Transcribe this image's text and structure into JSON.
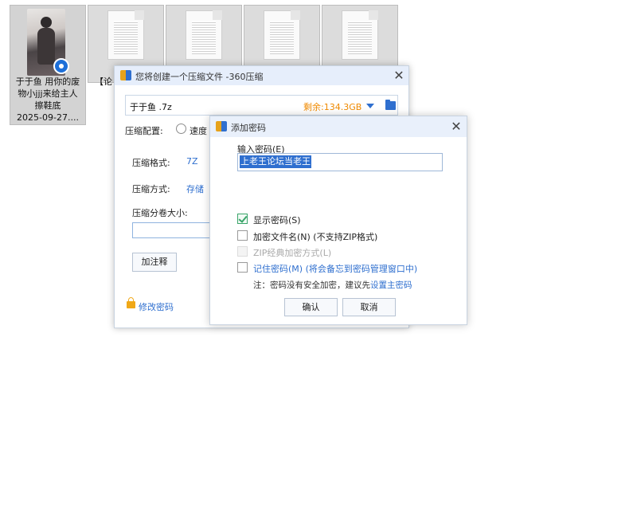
{
  "desktop": {
    "files": [
      {
        "label": "于于鱼 用你的废\n物小jjj来给主人\n擦鞋底\n2025-09-27....",
        "selected": true,
        "icon": "video-thumbnail"
      },
      {
        "label": "【论",
        "selected": false,
        "icon": "text-document-icon"
      },
      {
        "label": "",
        "selected": false,
        "icon": "text-document-icon"
      },
      {
        "label": "",
        "selected": false,
        "icon": "text-document-icon"
      },
      {
        "label": "",
        "selected": false,
        "icon": "text-document-icon"
      }
    ]
  },
  "main_dialog": {
    "title": "您将创建一个压缩文件 -360压缩",
    "path": "于于鱼 .7z",
    "free_space": "剩余:134.3GB",
    "config_label": "压缩配置:",
    "config_option": "速度",
    "format_label": "压缩格式:",
    "format_value": "7Z",
    "method_label": "压缩方式:",
    "method_value": "存储",
    "split_label": "压缩分卷大小:",
    "split_value": "",
    "comment_button": "加注释",
    "change_password_link": "修改密码"
  },
  "password_dialog": {
    "title": "添加密码",
    "input_label": "输入密码(E)",
    "password_value": "上老王论坛当老王",
    "options": [
      {
        "label": "显示密码(S)",
        "checked": true,
        "disabled": false
      },
      {
        "label": "加密文件名(N) (不支持ZIP格式)",
        "checked": false,
        "disabled": false
      },
      {
        "label": "ZIP经典加密方式(L)",
        "checked": false,
        "disabled": true
      },
      {
        "label": "记住密码(M) (将会备忘到密码管理窗口中)",
        "checked": false,
        "disabled": false
      }
    ],
    "note_prefix": "注：密码没有安全加密，建议先",
    "note_link": "设置主密码",
    "ok_button": "确认",
    "cancel_button": "取消"
  },
  "colors": {
    "accent": "#2f6fcf",
    "free_space": "#f08a00",
    "check_green": "#3aa56a",
    "titlebar": "#e6eefb"
  }
}
